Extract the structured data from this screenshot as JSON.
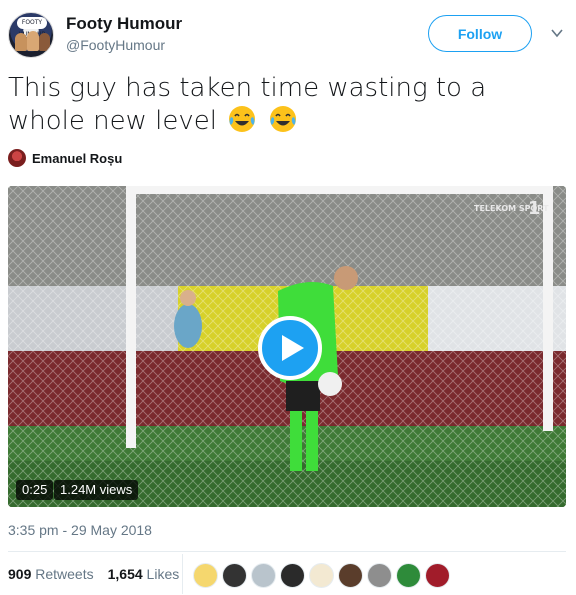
{
  "author": {
    "display_name": "Footy Humour",
    "handle": "@FootyHumour",
    "avatar_text": "FOOTY HUMOUR"
  },
  "actions": {
    "follow_label": "Follow"
  },
  "tweet": {
    "text": "This guy has taken time wasting to a whole new level",
    "emojis": [
      "face-with-tears-of-joy",
      "face-with-tears-of-joy"
    ]
  },
  "video": {
    "credit_name": "Emanuel Roșu",
    "duration": "0:25",
    "views": "1.24M views",
    "channel_logo": "TELEKOM SPORT",
    "channel_number": "1",
    "accent_color": "#1da1f2"
  },
  "meta": {
    "timestamp": "3:35 pm - 29 May 2018"
  },
  "stats": {
    "retweets_count": "909",
    "retweets_label": "Retweets",
    "likes_count": "1,654",
    "likes_label": "Likes"
  },
  "likers": [
    {
      "color": "#f5d76e"
    },
    {
      "color": "#333333"
    },
    {
      "color": "#b9c4cc"
    },
    {
      "color": "#2a2a2a"
    },
    {
      "color": "#f3e9d2"
    },
    {
      "color": "#5a3d2b"
    },
    {
      "color": "#8e8e8e"
    },
    {
      "color": "#2e8b3a"
    },
    {
      "color": "#a11c2a"
    }
  ]
}
